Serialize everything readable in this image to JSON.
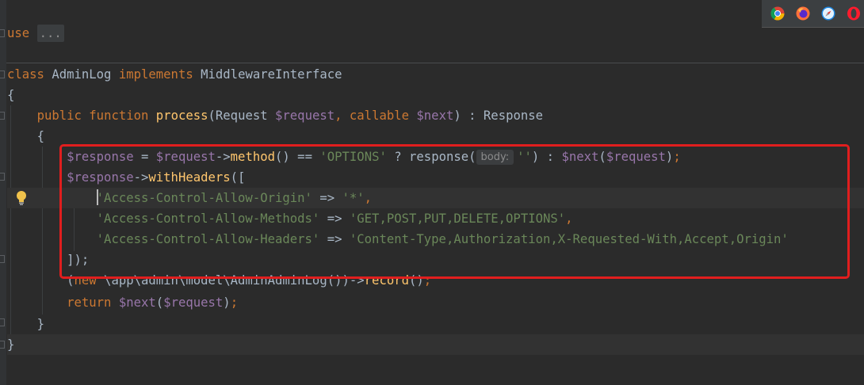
{
  "colors": {
    "keyword": "#cc7832",
    "variable": "#9876aa",
    "function": "#ffc66d",
    "string": "#6a8759",
    "text": "#a9b7c6",
    "highlight_border": "#e01e1e",
    "background": "#2b2b2b"
  },
  "code": {
    "use_keyword": "use",
    "use_collapsed": "...",
    "class_line": {
      "kw_class": "class",
      "class_name": "AdminLog",
      "kw_implements": "implements",
      "interface": "MiddlewareInterface"
    },
    "brace_open": "{",
    "method_line": {
      "kw_public": "public",
      "kw_function": "function",
      "name": "process",
      "open_paren": "(",
      "type_request": "Request",
      "param_request": "$request",
      "comma": ",",
      "type_callable": "callable",
      "param_next": "$next",
      "close_sig": ") : Response"
    },
    "method_brace_open": "{",
    "response_line": {
      "var_response": "$response",
      "assign": " = ",
      "var_request": "$request",
      "arrow": "->",
      "method": "method",
      "cmp": "() == ",
      "options_str": "'OPTIONS'",
      "ternary": " ? response(",
      "hint_body": "body:",
      "empty_str": "''",
      "colon": ") : ",
      "var_next": "$next",
      "call_open": "(",
      "var_request2": "$request",
      "call_close": ")",
      "semicolon": ";"
    },
    "headers_line": {
      "var_response": "$response",
      "arrow": "->",
      "method": "withHeaders",
      "open": "(["
    },
    "headers": [
      {
        "key": "'Access-Control-Allow-Origin'",
        "arrow": " => ",
        "value": "'*'",
        "comma": ","
      },
      {
        "key": "'Access-Control-Allow-Methods'",
        "arrow": " => ",
        "value": "'GET,POST,PUT,DELETE,OPTIONS'",
        "comma": ","
      },
      {
        "key": "'Access-Control-Allow-Headers'",
        "arrow": " => ",
        "value": "'Content-Type,Authorization,X-Requested-With,Accept,Origin'",
        "comma": ""
      }
    ],
    "headers_close": "]);",
    "record_line": {
      "open": "(",
      "kw_new": "new",
      "class_path": " \\app\\admin\\model\\AdminAdminLog",
      "call": "())->",
      "method": "record",
      "close": "()",
      "semicolon": ";"
    },
    "return_line": {
      "kw_return": "return",
      "var_next": "$next",
      "open": "(",
      "var_request": "$request",
      "close": ")",
      "semicolon": ";"
    },
    "method_brace_close": "}",
    "brace_close": "}"
  },
  "browser_icons": [
    "chrome-icon",
    "firefox-icon",
    "safari-icon",
    "opera-icon"
  ]
}
